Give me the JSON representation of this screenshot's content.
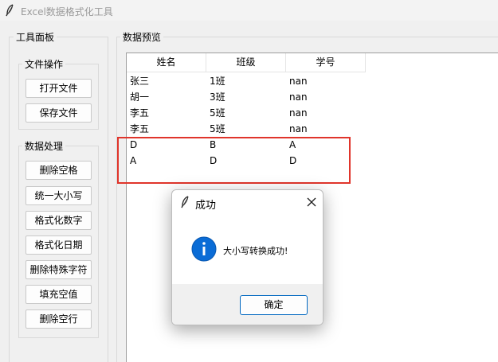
{
  "window": {
    "title": "Excel数据格式化工具"
  },
  "tool_panel": {
    "label": "工具面板",
    "file_ops": {
      "label": "文件操作",
      "buttons": [
        "打开文件",
        "保存文件"
      ]
    },
    "data_proc": {
      "label": "数据处理",
      "buttons": [
        "删除空格",
        "统一大小写",
        "格式化数字",
        "格式化日期",
        "删除特殊字符",
        "填充空值",
        "删除空行"
      ]
    }
  },
  "preview": {
    "label": "数据预览",
    "columns": [
      "姓名",
      "班级",
      "学号"
    ],
    "rows": [
      [
        "张三",
        "1班",
        "nan"
      ],
      [
        "胡一",
        "3班",
        "nan"
      ],
      [
        "李五",
        "5班",
        "nan"
      ],
      [
        "李五",
        "5班",
        "nan"
      ],
      [
        "D",
        "B",
        "A"
      ],
      [
        "A",
        "D",
        "D"
      ]
    ]
  },
  "dialog": {
    "title": "成功",
    "message": "大小写转换成功!",
    "ok_label": "确定",
    "info_icon": "info-icon",
    "accent_color": "#0067c0"
  },
  "highlight_color": "#e0352b"
}
